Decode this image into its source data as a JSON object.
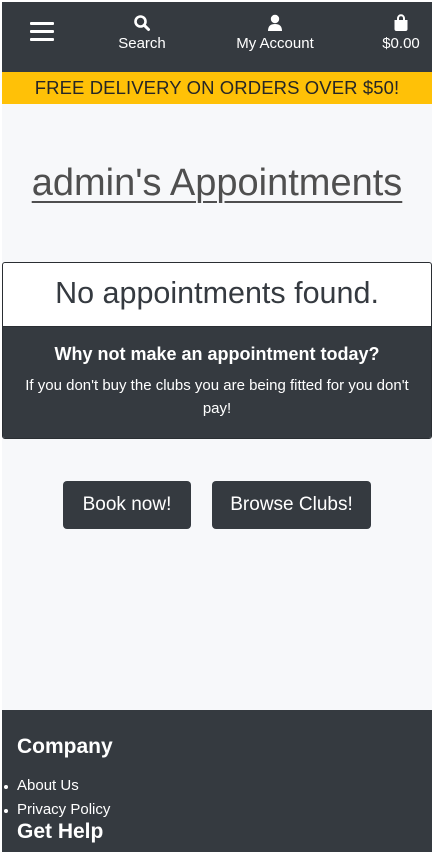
{
  "nav": {
    "search_label": "Search",
    "account_label": "My Account",
    "bag_total": "$0.00",
    "icons": [
      "menu-icon",
      "search-icon",
      "user-icon",
      "shopping-bag-icon"
    ]
  },
  "banner": {
    "text": "FREE DELIVERY ON ORDERS OVER $50!"
  },
  "page": {
    "title": "admin's Appointments"
  },
  "card": {
    "header": "No appointments found.",
    "subheading": "Why not make an appointment today?",
    "text": "If you don't buy the clubs you are being fitted for you don't pay!"
  },
  "actions": {
    "book_label": "Book now!",
    "browse_label": "Browse Clubs!"
  },
  "footer": {
    "company_heading": "Company",
    "links": [
      "About Us",
      "Privacy Policy"
    ],
    "help_heading": "Get Help"
  },
  "colors": {
    "dark": "#353a40",
    "banner": "#ffc107",
    "background": "#f7f8fa"
  }
}
